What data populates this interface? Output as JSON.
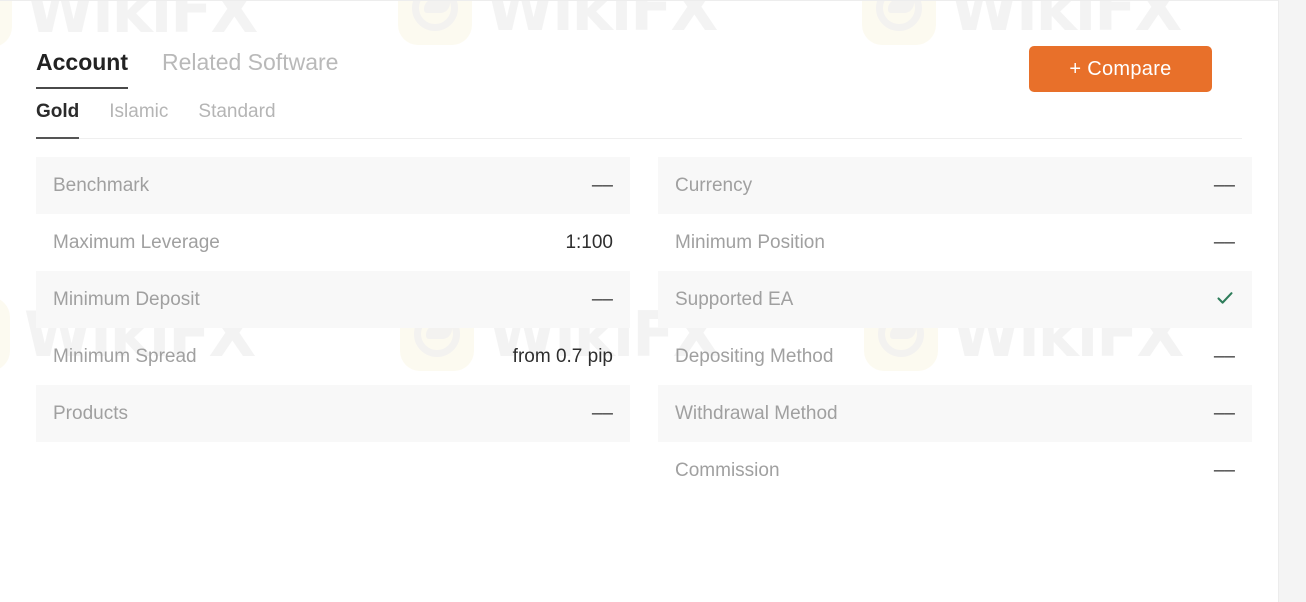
{
  "colors": {
    "accent": "#e8702a",
    "check": "#2f7d5b",
    "row_shade": "#f8f8f8",
    "label": "#a0a0a0",
    "value": "#2e2e2e"
  },
  "watermark": {
    "text": "WikiFX",
    "logo_icon": "wikifx-logo-icon"
  },
  "main_tabs": [
    {
      "label": "Account",
      "active": true
    },
    {
      "label": "Related Software",
      "active": false
    }
  ],
  "compare_button": {
    "label": "+ Compare"
  },
  "sub_tabs": [
    {
      "label": "Gold",
      "active": true
    },
    {
      "label": "Islamic",
      "active": false
    },
    {
      "label": "Standard",
      "active": false
    }
  ],
  "left_column": [
    {
      "label": "Benchmark",
      "value": "––",
      "shaded": true,
      "icon": null
    },
    {
      "label": "Maximum Leverage",
      "value": "1:100",
      "shaded": false,
      "icon": null
    },
    {
      "label": "Minimum Deposit",
      "value": "––",
      "shaded": true,
      "icon": null
    },
    {
      "label": "Minimum Spread",
      "value": "from 0.7 pip",
      "shaded": false,
      "icon": null
    },
    {
      "label": "Products",
      "value": "––",
      "shaded": true,
      "icon": null
    }
  ],
  "right_column": [
    {
      "label": "Currency",
      "value": "––",
      "shaded": true,
      "icon": null
    },
    {
      "label": "Minimum Position",
      "value": "––",
      "shaded": false,
      "icon": null
    },
    {
      "label": "Supported EA",
      "value": "",
      "shaded": true,
      "icon": "check-icon"
    },
    {
      "label": "Depositing Method",
      "value": "––",
      "shaded": false,
      "icon": null
    },
    {
      "label": "Withdrawal Method",
      "value": "––",
      "shaded": true,
      "icon": null
    },
    {
      "label": "Commission",
      "value": "––",
      "shaded": false,
      "icon": null
    }
  ]
}
